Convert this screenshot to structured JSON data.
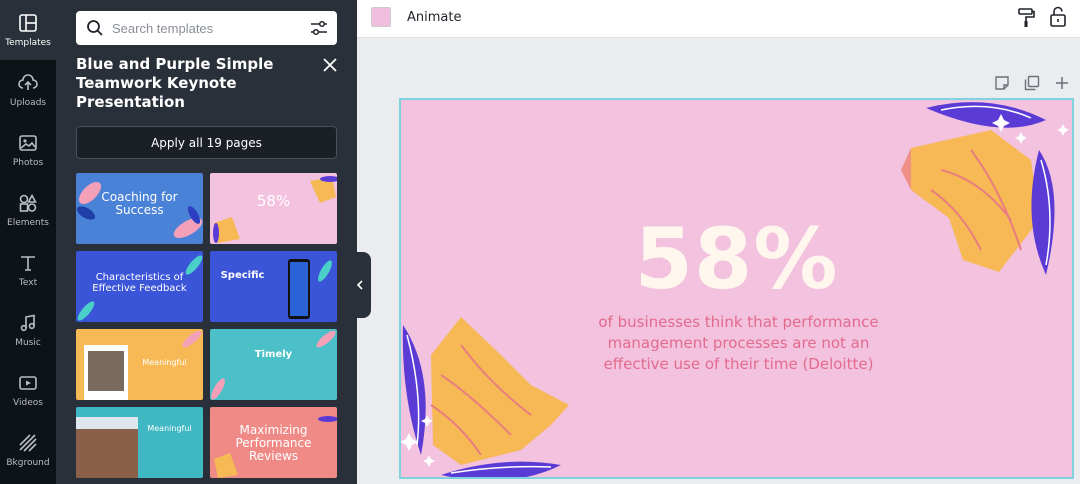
{
  "rail": {
    "items": [
      {
        "label": "Templates",
        "icon": "templates-icon"
      },
      {
        "label": "Uploads",
        "icon": "upload-icon"
      },
      {
        "label": "Photos",
        "icon": "photos-icon"
      },
      {
        "label": "Elements",
        "icon": "elements-icon"
      },
      {
        "label": "Text",
        "icon": "text-icon"
      },
      {
        "label": "Music",
        "icon": "music-icon"
      },
      {
        "label": "Videos",
        "icon": "videos-icon"
      },
      {
        "label": "Bkground",
        "icon": "background-icon"
      }
    ]
  },
  "panel": {
    "search_placeholder": "Search templates",
    "title": "Blue and Purple Simple Teamwork Keynote Presentation",
    "apply_label": "Apply all 19 pages",
    "thumbnails": [
      {
        "text": "Coaching for Success",
        "bg": "#4a82d8"
      },
      {
        "text": "58%",
        "bg": "#f2c2de"
      },
      {
        "text": "Characteristics of Effective Feedback",
        "bg": "#3b55d9"
      },
      {
        "text": "Specific",
        "bg": "#3b55d9"
      },
      {
        "text": "Meaningful",
        "bg": "#f6b956"
      },
      {
        "text": "Timely",
        "bg": "#4cc0c8"
      },
      {
        "text": "Meaningful",
        "bg": "#3fb8c4"
      },
      {
        "text": "Maximizing Performance Reviews",
        "bg": "#f08a86"
      }
    ]
  },
  "topbar": {
    "animate_label": "Animate",
    "swatch_color": "#f0bfde"
  },
  "slide": {
    "big_number": "58%",
    "subtitle": "of businesses think that performance management processes are not an effective use of their time (Deloitte)",
    "background": "#f2c2de"
  }
}
